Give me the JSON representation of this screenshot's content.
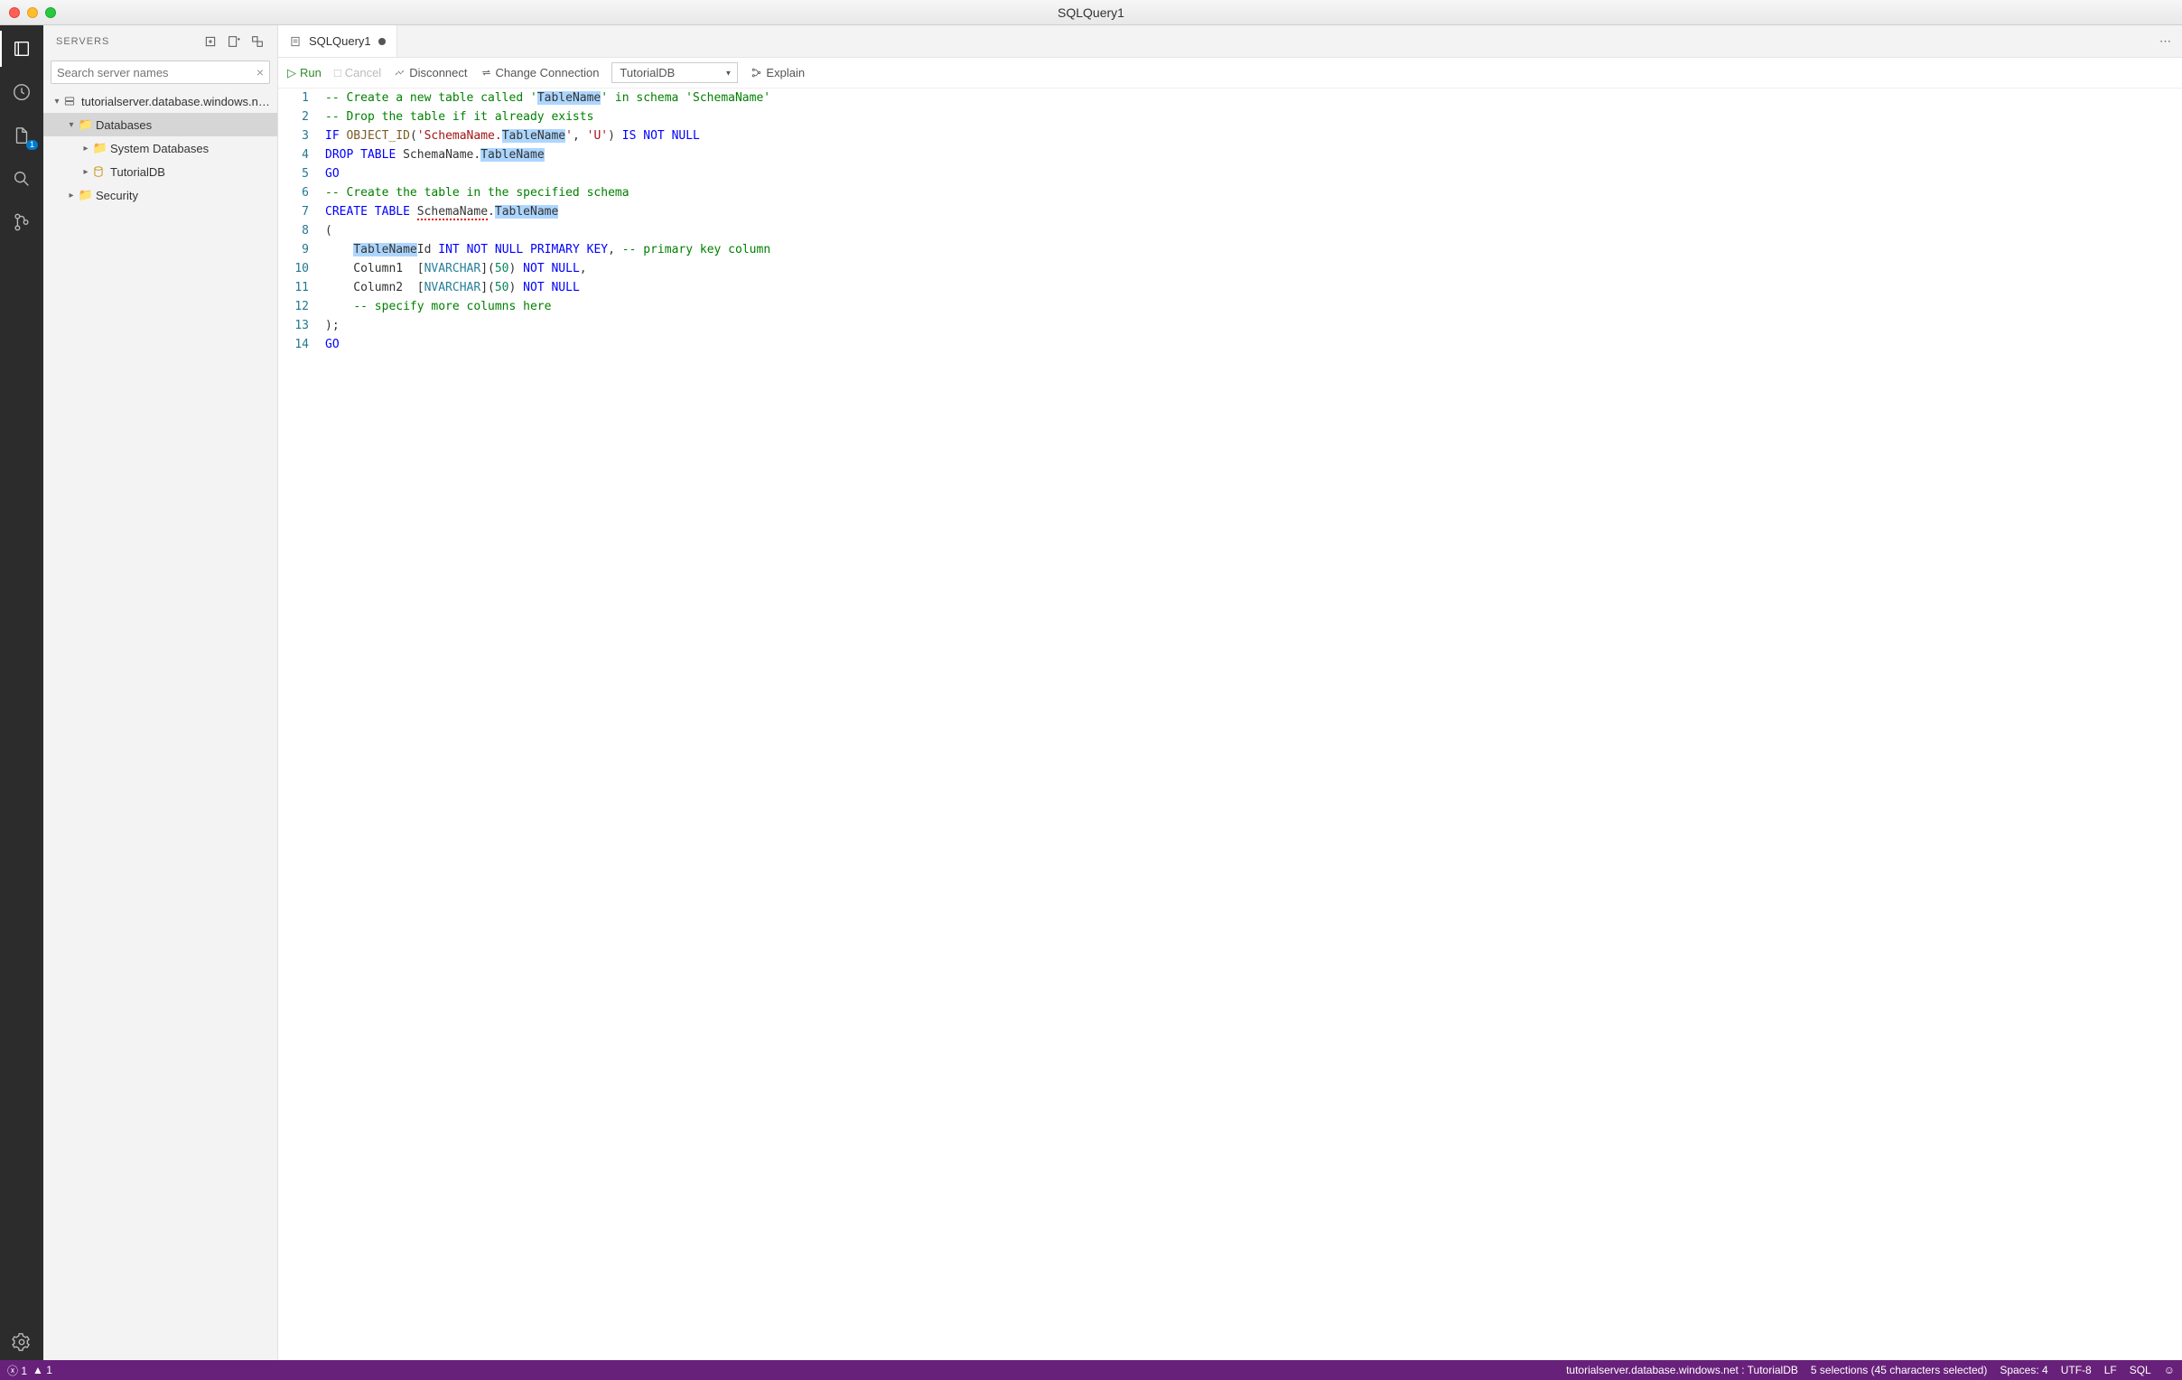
{
  "window": {
    "title": "SQLQuery1"
  },
  "sidebar": {
    "title": "SERVERS",
    "search_placeholder": "Search server names",
    "tree": {
      "server": "tutorialserver.database.windows.n…",
      "databases": "Databases",
      "sysdb": "System Databases",
      "tutdb": "TutorialDB",
      "security": "Security"
    }
  },
  "tab": {
    "label": "SQLQuery1"
  },
  "toolbar": {
    "run": "Run",
    "cancel": "Cancel",
    "disconnect": "Disconnect",
    "change_conn": "Change Connection",
    "db_selected": "TutorialDB",
    "explain": "Explain"
  },
  "code": {
    "lines": [
      "1",
      "2",
      "3",
      "4",
      "5",
      "6",
      "7",
      "8",
      "9",
      "10",
      "11",
      "12",
      "13",
      "14"
    ]
  },
  "statusbar": {
    "errors": "1",
    "warnings": "1",
    "connection": "tutorialserver.database.windows.net : TutorialDB",
    "selection": "5 selections (45 characters selected)",
    "spaces": "Spaces: 4",
    "encoding": "UTF-8",
    "eol": "LF",
    "lang": "SQL"
  },
  "activity_badge": "1"
}
